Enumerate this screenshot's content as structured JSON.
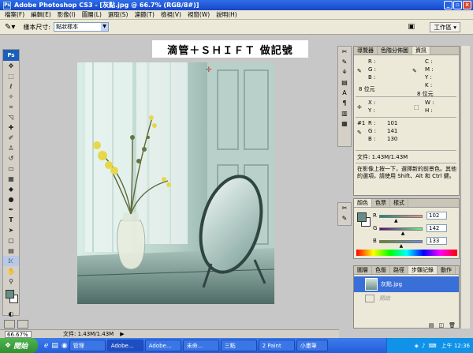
{
  "window": {
    "title": "Adobe Photoshop CS3 - [灰點.jpg @ 66.7% (RGB/8#)]",
    "ps_mini": "Ps"
  },
  "menu": [
    "檔案(F)",
    "編輯(E)",
    "影像(I)",
    "圖層(L)",
    "選取(S)",
    "濾鏡(T)",
    "檢視(V)",
    "視窗(W)",
    "說明(H)"
  ],
  "options": {
    "sample_label": "樣本尺寸:",
    "sample_value": "點狀樣本",
    "workspace_label": "工作區 ▾"
  },
  "toolbox": {
    "logo": "Ps"
  },
  "canvas": {
    "caption": "滴管＋ＳＨＩＦＴ 做記號"
  },
  "status": {
    "zoom": "66.67%",
    "doc": "文件: 1.43M/1.43M"
  },
  "info_panel": {
    "tabs": [
      "導覽器",
      "色階分佈圖",
      "資訊"
    ],
    "rgb_labels": [
      "R :",
      "G :",
      "B :"
    ],
    "cmyk_labels": [
      "C :",
      "M :",
      "Y :",
      "K :"
    ],
    "bit_left": "8 位元",
    "bit_right": "8 位元",
    "xy_labels": [
      "X :",
      "Y :"
    ],
    "wh_labels": [
      "W :",
      "H :"
    ],
    "sample_id": "#1",
    "sample_r_label": "R :",
    "sample_g_label": "G :",
    "sample_b_label": "B :",
    "sample_r": "101",
    "sample_g": "141",
    "sample_b": "130",
    "doc": "文件: 1.43M/1.43M",
    "hint": "在影像上按一下，選擇新的前景色。其他的選項，請使用 Shift、Alt 和 Ctrl 鍵。"
  },
  "color_panel": {
    "tabs": [
      "顏色",
      "色票",
      "樣式"
    ],
    "r_label": "R",
    "g_label": "G",
    "b_label": "B",
    "r": "102",
    "g": "142",
    "b": "133",
    "r_pos": 0.4,
    "g_pos": 0.56,
    "b_pos": 0.52
  },
  "history_panel": {
    "tabs": [
      "圖層",
      "色版",
      "路徑",
      "步驟記錄",
      "動作"
    ],
    "items": [
      "灰點.jpg",
      "開啟"
    ]
  },
  "taskbar": {
    "start": "開始",
    "tasks": [
      "管理",
      "Adobe...",
      "Adobe...",
      "未命...",
      "三點",
      "2 Paint",
      "小畫筆"
    ],
    "clock": "上午 12:36"
  },
  "colors": {
    "fg": "#658e85",
    "bg": "#ffffff",
    "title": "#1f5ad6"
  }
}
